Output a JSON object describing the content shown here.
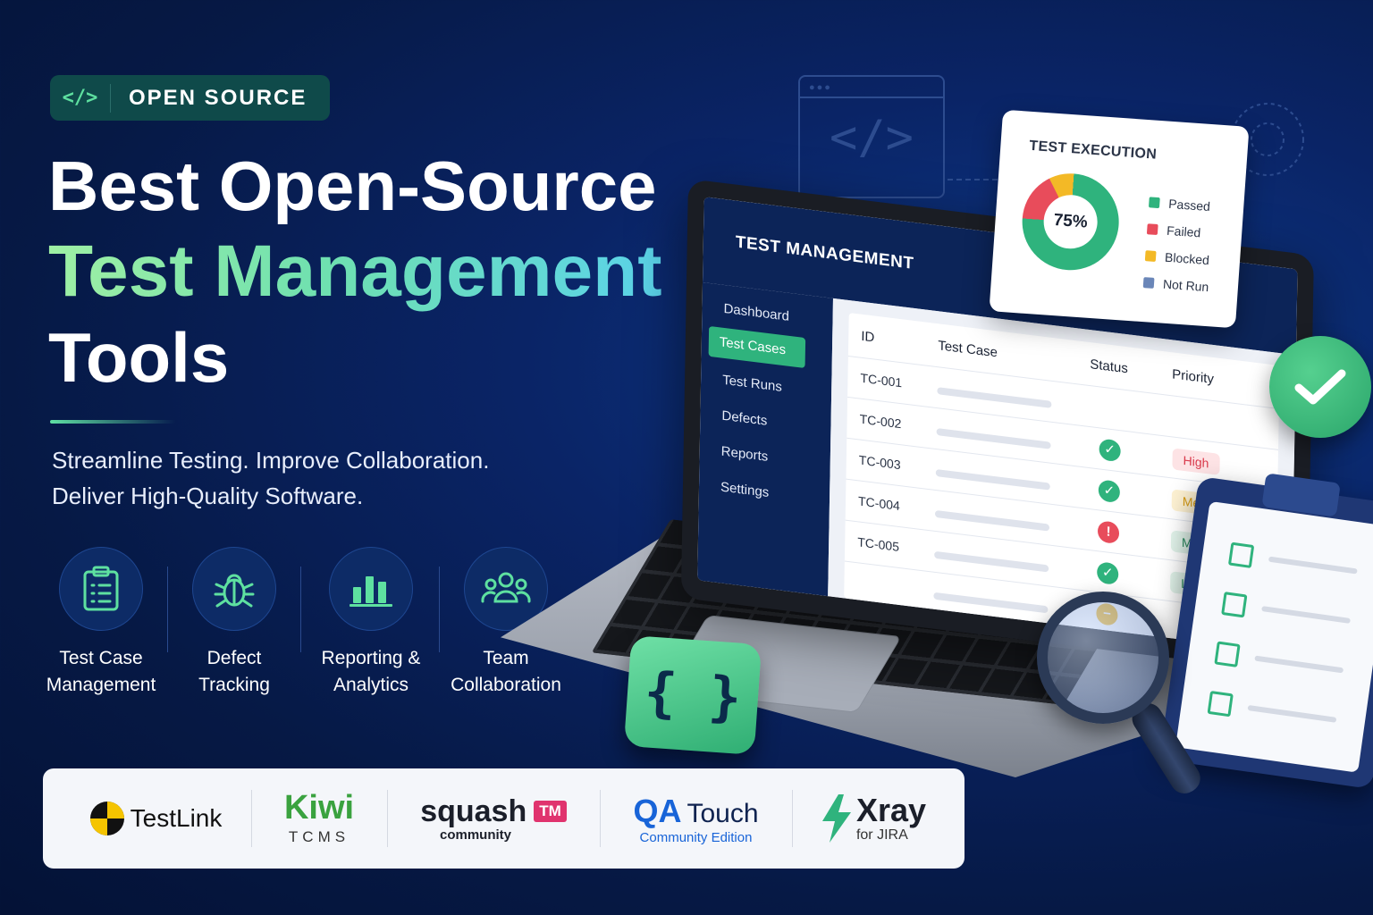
{
  "badge": {
    "icon": "code-icon",
    "label": "OPEN SOURCE"
  },
  "headline": {
    "line1": "Best Open-Source",
    "line2": "Test Management",
    "line3": "Tools"
  },
  "subtitle": {
    "line1": "Streamline Testing. Improve Collaboration.",
    "line2": "Deliver High-Quality Software."
  },
  "features": [
    {
      "icon": "clipboard-list-icon",
      "line1": "Test Case",
      "line2": "Management"
    },
    {
      "icon": "bug-icon",
      "line1": "Defect",
      "line2": "Tracking"
    },
    {
      "icon": "bar-chart-icon",
      "line1": "Reporting &",
      "line2": "Analytics"
    },
    {
      "icon": "team-icon",
      "line1": "Team",
      "line2": "Collaboration"
    }
  ],
  "tools": [
    {
      "name": "TestLink"
    },
    {
      "name": "Kiwi",
      "sub": "TCMS"
    },
    {
      "name": "squash",
      "tag": "TM",
      "sub": "community"
    },
    {
      "name_part1": "QA",
      "name_part2": "Touch",
      "sub": "Community Edition"
    },
    {
      "name": "Xray",
      "sub": "for JIRA"
    }
  ],
  "app": {
    "title": "TEST MANAGEMENT",
    "nav": [
      "Dashboard",
      "Test Cases",
      "Test Runs",
      "Defects",
      "Reports",
      "Settings"
    ],
    "active_nav": "Test Cases",
    "columns": [
      "ID",
      "Test Case",
      "Status",
      "Priority"
    ],
    "rows": [
      {
        "id": "TC-001",
        "status": "",
        "priority": ""
      },
      {
        "id": "TC-002",
        "status": "passed",
        "priority": "High"
      },
      {
        "id": "TC-003",
        "status": "passed",
        "priority": "Medium"
      },
      {
        "id": "TC-004",
        "status": "failed",
        "priority": "Medium"
      },
      {
        "id": "TC-005",
        "status": "passed",
        "priority": "Low"
      }
    ]
  },
  "execution": {
    "title": "TEST EXECUTION",
    "percent_label": "75%",
    "legend": [
      {
        "label": "Passed",
        "color": "#2fb37d"
      },
      {
        "label": "Failed",
        "color": "#e84c5b"
      },
      {
        "label": "Blocked",
        "color": "#f3b926"
      },
      {
        "label": "Not Run",
        "color": "#6a86b8"
      }
    ]
  },
  "colors": {
    "accent_green": "#2fb37d",
    "background_navy": "#061945",
    "danger": "#e84c5b",
    "warning": "#f3b926"
  }
}
